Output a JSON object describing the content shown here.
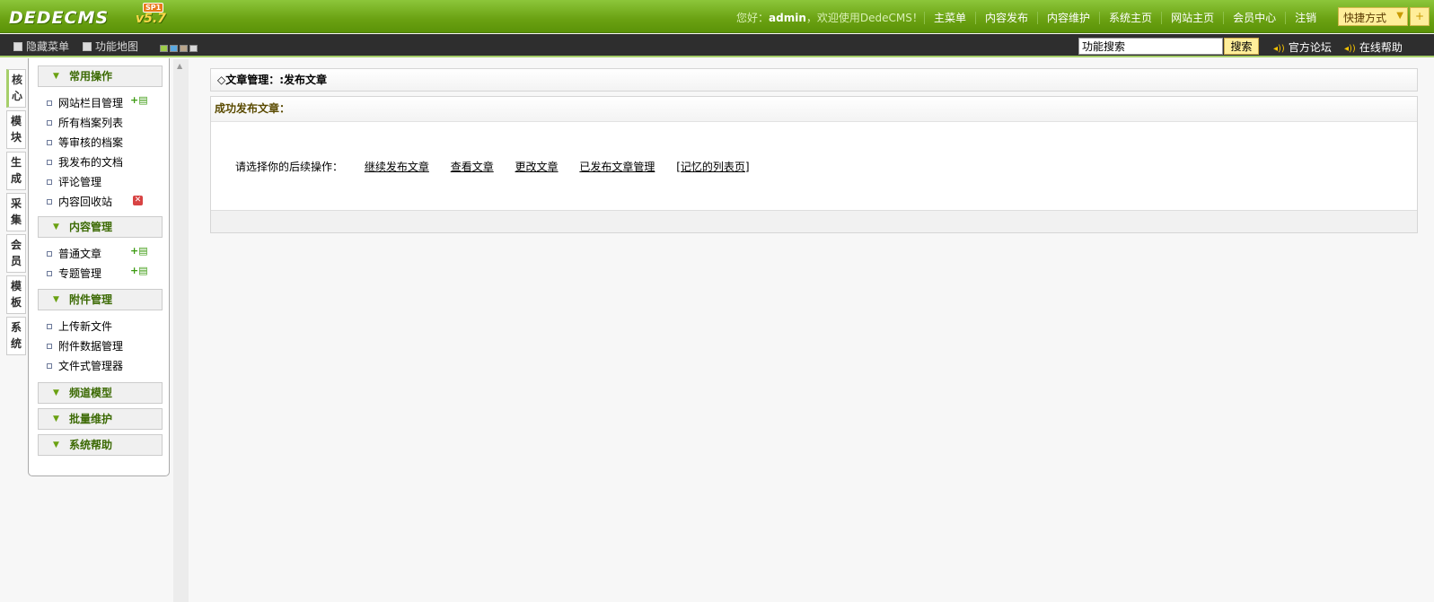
{
  "header": {
    "logo": "DEDECMS",
    "version": "v5.7",
    "version_badge": "SP1",
    "welcome_prefix": "您好：",
    "username": "admin",
    "welcome_suffix": "，欢迎使用DedeCMS！",
    "nav": [
      "主菜单",
      "内容发布",
      "内容维护",
      "系统主页",
      "网站主页",
      "会员中心",
      "注销"
    ],
    "quick_label": "快捷方式",
    "quick_plus": "+"
  },
  "subbar": {
    "hide_menu": "隐藏菜单",
    "site_map": "功能地图",
    "search_value": "功能搜索",
    "search_button": "搜索",
    "forum": "官方论坛",
    "help": "在线帮助"
  },
  "vtabs": [
    "核心",
    "模块",
    "生成",
    "采集",
    "会员",
    "模板",
    "系统"
  ],
  "menu": {
    "groups": [
      {
        "title": "常用操作",
        "items": [
          "网站栏目管理",
          "所有档案列表",
          "等审核的档案",
          "我发布的文档",
          "评论管理",
          "内容回收站"
        ]
      },
      {
        "title": "内容管理",
        "items": [
          "普通文章",
          "专题管理"
        ]
      },
      {
        "title": "附件管理",
        "items": [
          "上传新文件",
          "附件数据管理",
          "文件式管理器"
        ]
      },
      {
        "title": "频道模型",
        "items": []
      },
      {
        "title": "批量维护",
        "items": []
      },
      {
        "title": "系统帮助",
        "items": []
      }
    ]
  },
  "main": {
    "page_title": "◇文章管理：:发布文章",
    "result_title": "成功发布文章：",
    "prompt": "请选择你的后续操作：",
    "actions": [
      "继续发布文章",
      "查看文章",
      "更改文章",
      "已发布文章管理",
      "[记忆的列表页]"
    ]
  },
  "colors": {
    "brand_green": "#6aa112",
    "subbar_dark": "#2e2e2e",
    "highlight_yellow": "#ffee9a"
  }
}
